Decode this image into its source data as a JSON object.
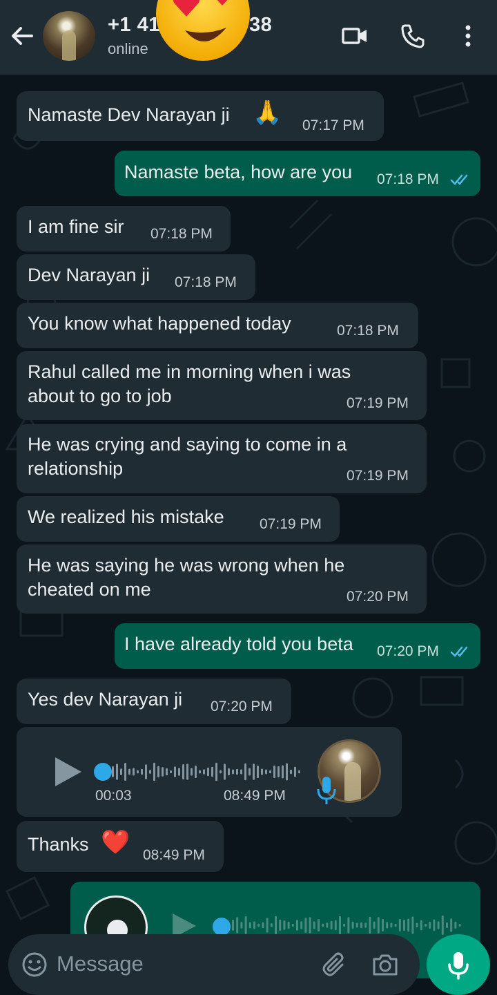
{
  "header": {
    "phone_start": "+1 41",
    "phone_end": "38",
    "status": "online"
  },
  "messages": [
    {
      "dir": "in",
      "text": "Namaste Dev Narayan ji",
      "emoji": "🙏",
      "time": "07:17 PM"
    },
    {
      "dir": "out",
      "text": "Namaste beta, how are you",
      "time": "07:18 PM",
      "ticks": "read"
    },
    {
      "dir": "in",
      "text": "I am fine sir",
      "time": "07:18 PM"
    },
    {
      "dir": "in",
      "text": "Dev Narayan ji",
      "time": "07:18 PM"
    },
    {
      "dir": "in",
      "text": "You know what happened today",
      "time": "07:18 PM"
    },
    {
      "dir": "in",
      "line1": "Rahul called me in morning when i was",
      "line2": "about to go to job",
      "time": "07:19 PM"
    },
    {
      "dir": "in",
      "line1": "He was crying and saying to come in a",
      "line2": "relationship",
      "time": "07:19 PM"
    },
    {
      "dir": "in",
      "text": "We realized his mistake",
      "time": "07:19 PM"
    },
    {
      "dir": "in",
      "line1": "He was saying he was wrong when he",
      "line2": "cheated on me",
      "time": "07:20 PM"
    },
    {
      "dir": "out",
      "text": "I have already told you beta",
      "time": "07:20 PM",
      "ticks": "read"
    },
    {
      "dir": "in",
      "text": "Yes dev Narayan ji",
      "time": "07:20 PM"
    },
    {
      "dir": "in",
      "type": "voice",
      "duration": "00:03",
      "time": "08:49 PM",
      "progress": 0.0
    },
    {
      "dir": "in",
      "text": "Thanks",
      "emoji": "❤️",
      "time": "08:49 PM"
    },
    {
      "dir": "out",
      "type": "voice",
      "partial": true
    }
  ],
  "composer": {
    "placeholder": "Message"
  },
  "icons": [
    "back-arrow-icon",
    "video-call-icon",
    "voice-call-icon",
    "more-options-icon",
    "emoji-icon",
    "attach-icon",
    "camera-icon",
    "mic-icon",
    "play-icon",
    "double-check-icon"
  ],
  "colors": {
    "background": "#0b141a",
    "header": "#1f2c34",
    "incoming_bubble": "#202c33",
    "outgoing_bubble": "#005c4b",
    "accent": "#00a884",
    "read_ticks": "#53bdeb"
  }
}
